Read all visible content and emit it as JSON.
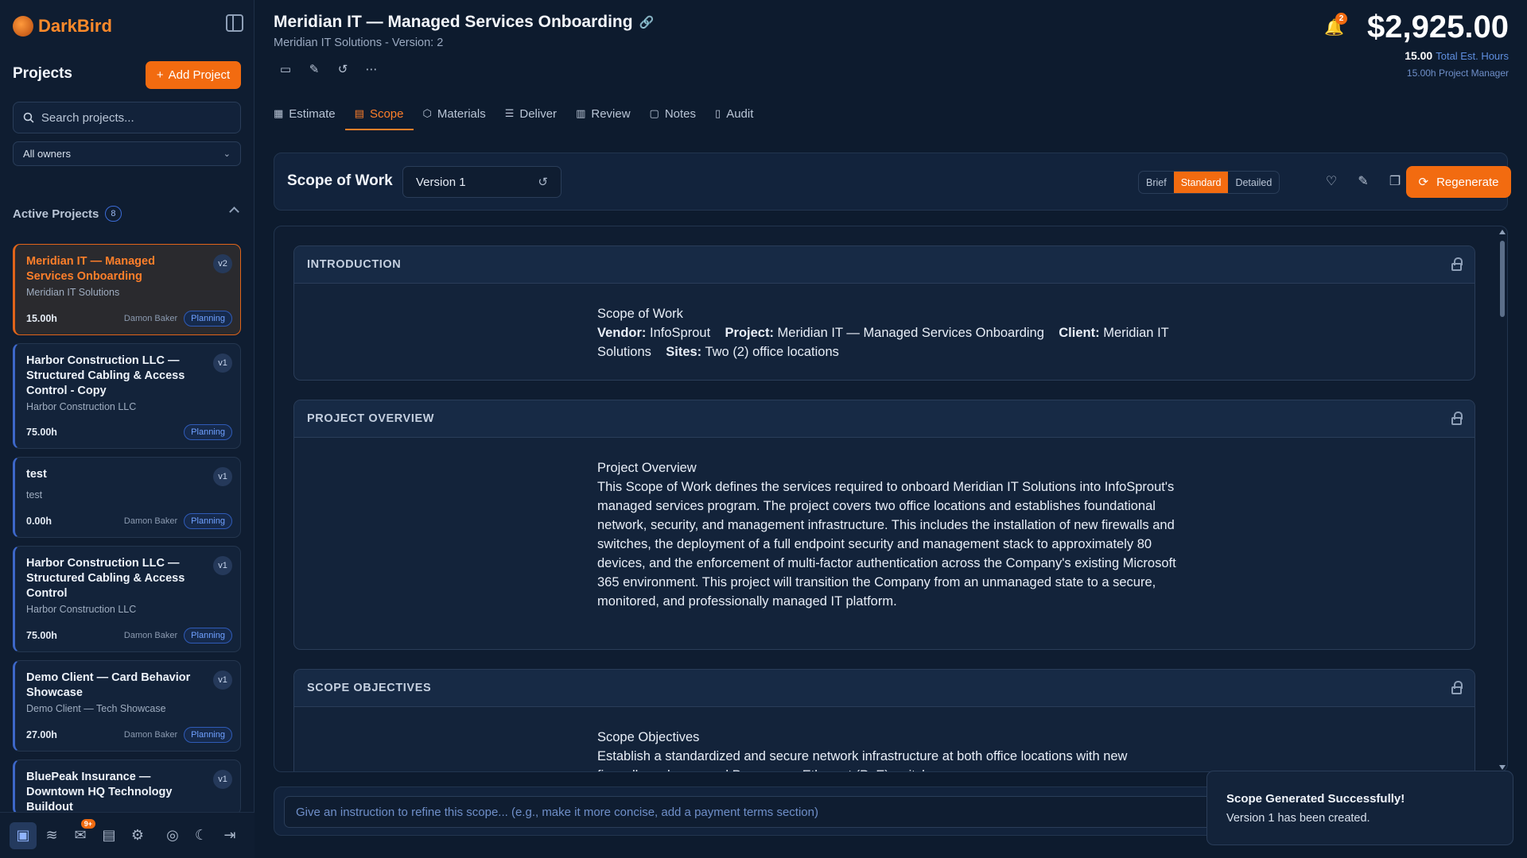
{
  "app": {
    "name": "DarkBird"
  },
  "sidebar": {
    "projects_title": "Projects",
    "add_project_label": "Add Project",
    "search_placeholder": "Search projects...",
    "owner_filter": "All owners",
    "active_projects_label": "Active Projects",
    "active_count": "8",
    "projects": [
      {
        "title": "Meridian IT — Managed Services Onboarding",
        "client": "Meridian IT Solutions",
        "hours": "15.00h",
        "owner": "Damon Baker",
        "status": "Planning",
        "version": "v2",
        "active": true
      },
      {
        "title": "Harbor Construction LLC — Structured Cabling & Access Control - Copy",
        "client": "Harbor Construction LLC",
        "hours": "75.00h",
        "owner": "",
        "status": "Planning",
        "version": "v1"
      },
      {
        "title": "test",
        "client": "test",
        "hours": "0.00h",
        "owner": "Damon Baker",
        "status": "Planning",
        "version": "v1"
      },
      {
        "title": "Harbor Construction LLC — Structured Cabling & Access Control",
        "client": "Harbor Construction LLC",
        "hours": "75.00h",
        "owner": "Damon Baker",
        "status": "Planning",
        "version": "v1"
      },
      {
        "title": "Demo Client — Card Behavior Showcase",
        "client": "Demo Client — Tech Showcase",
        "hours": "27.00h",
        "owner": "Damon Baker",
        "status": "Planning",
        "version": "v1"
      },
      {
        "title": "BluePeak Insurance — Downtown HQ Technology Buildout",
        "client": "",
        "hours": "",
        "owner": "",
        "status": "",
        "version": "v1"
      }
    ],
    "footer_notif_count": "9+"
  },
  "header": {
    "title": "Meridian IT — Managed Services Onboarding",
    "subtitle": "Meridian IT Solutions - Version: 2",
    "notif_count": "2",
    "price": "$2,925.00",
    "total_hours_value": "15.00",
    "total_hours_label": "Total Est. Hours",
    "pm_line": "15.00h Project Manager"
  },
  "tabs": [
    {
      "label": "Estimate",
      "icon": "calculator-icon"
    },
    {
      "label": "Scope",
      "icon": "document-icon",
      "active": true
    },
    {
      "label": "Materials",
      "icon": "box-icon"
    },
    {
      "label": "Deliver",
      "icon": "checklist-icon"
    },
    {
      "label": "Review",
      "icon": "bar-chart-icon"
    },
    {
      "label": "Notes",
      "icon": "message-icon"
    },
    {
      "label": "Audit",
      "icon": "clipboard-icon"
    }
  ],
  "scope_bar": {
    "title": "Scope of Work",
    "version": "Version 1",
    "detail_options": [
      "Brief",
      "Standard",
      "Detailed"
    ],
    "detail_selected": "Standard",
    "regenerate_label": "Regenerate"
  },
  "sections": {
    "introduction": {
      "title": "INTRODUCTION",
      "heading": "Scope of Work",
      "vendor_label": "Vendor:",
      "vendor": "InfoSprout",
      "project_label": "Project:",
      "project": "Meridian IT — Managed Services Onboarding",
      "client_label": "Client:",
      "client": "Meridian IT Solutions",
      "sites_label": "Sites:",
      "sites": "Two (2) office locations"
    },
    "overview": {
      "title": "PROJECT OVERVIEW",
      "heading": "Project Overview",
      "body": "This Scope of Work defines the services required to onboard Meridian IT Solutions into InfoSprout's managed services program. The project covers two office locations and establishes foundational network, security, and management infrastructure. This includes the installation of new firewalls and switches, the deployment of a full endpoint security and management stack to approximately 80 devices, and the enforcement of multi-factor authentication across the Company's existing Microsoft 365 environment. This project will transition the Company from an unmanaged state to a secure, monitored, and professionally managed IT platform."
    },
    "objectives": {
      "title": "SCOPE OBJECTIVES",
      "heading": "Scope Objectives",
      "body": "Establish a standardized and secure network infrastructure at both office locations with new firewalls and managed Power over Ethernet (PoE) switches."
    }
  },
  "refine": {
    "placeholder": "Give an instruction to refine this scope... (e.g., make it more concise, add a payment terms section)"
  },
  "toast": {
    "title": "Scope Generated Successfully!",
    "message": "Version 1 has been created."
  },
  "colors": {
    "accent": "#f26b10",
    "background": "#0d1b2e",
    "status_planning": "#6fa0ff"
  }
}
